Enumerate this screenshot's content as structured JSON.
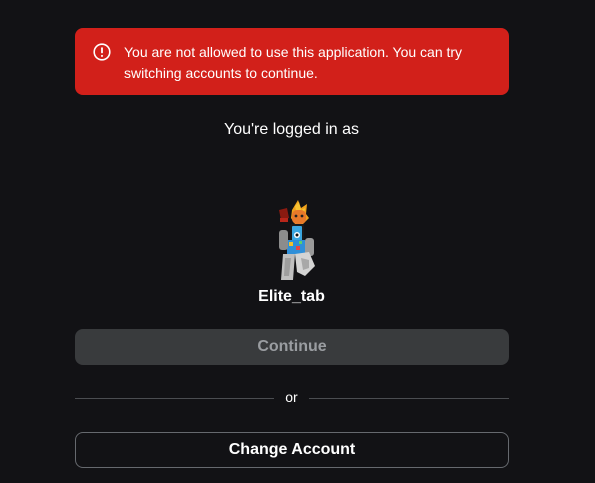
{
  "alert": {
    "icon": "exclamation-circle-icon",
    "message": "You are not allowed to use this application. You can try switching accounts to continue.",
    "background": "#d2201a"
  },
  "account": {
    "intro": "You're logged in as",
    "username": "Elite_tab",
    "avatar_icon": "roblox-avatar"
  },
  "actions": {
    "continue_label": "Continue",
    "divider_label": "or",
    "change_account_label": "Change Account"
  }
}
